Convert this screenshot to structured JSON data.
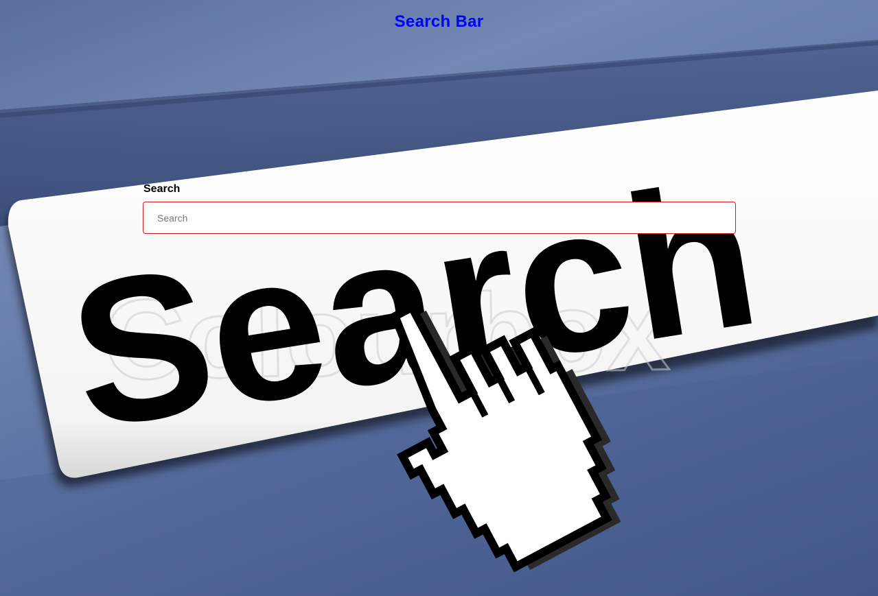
{
  "page": {
    "title": "Search Bar"
  },
  "search": {
    "label": "Search",
    "placeholder": "Search",
    "value": ""
  },
  "background": {
    "banner_word": "Search",
    "watermark": "Colourbox",
    "icon": "hand-pointer-icon"
  },
  "colors": {
    "title": "#0000ff",
    "input_border": "#d21c1c",
    "background": "#5a6f9c"
  }
}
